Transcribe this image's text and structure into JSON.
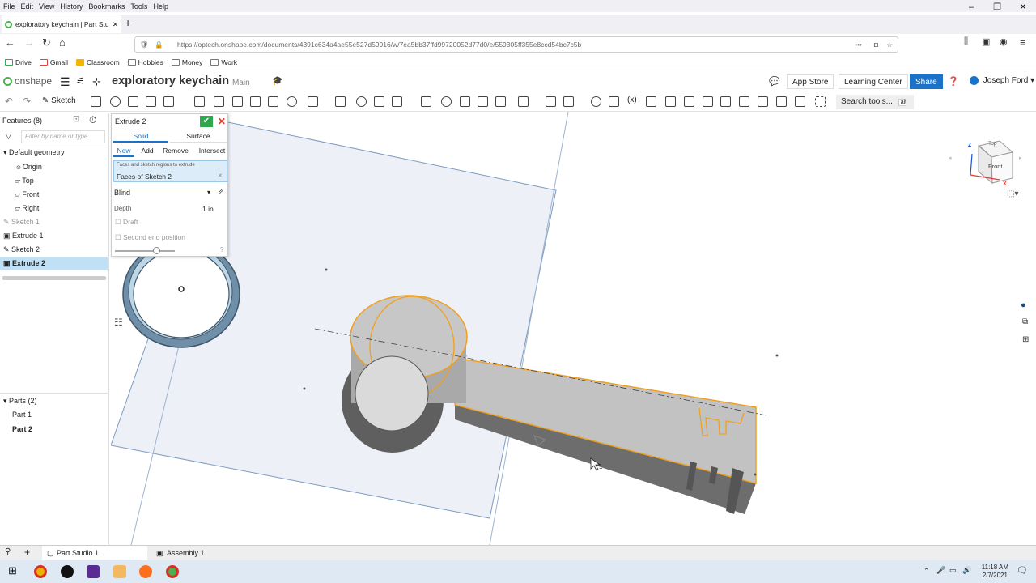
{
  "browser": {
    "menu": [
      "File",
      "Edit",
      "View",
      "History",
      "Bookmarks",
      "Tools",
      "Help"
    ],
    "tab_title": "exploratory keychain | Part Stu",
    "url": "https://optech.onshape.com/documents/4391c634a4ae55e527d59916/w/7ea5bb37ffd99720052d77d0/e/559305ff355e8ccd54bc7c5b",
    "bookmarks": [
      "Drive",
      "Gmail",
      "Classroom",
      "Hobbies",
      "Money",
      "Work"
    ]
  },
  "app": {
    "logo_text": "onshape",
    "document_title": "exploratory keychain",
    "branch": "Main",
    "app_store": "App Store",
    "learning_center": "Learning Center",
    "share": "Share",
    "user": "Joseph Ford"
  },
  "toolbar": {
    "sketch": "Sketch",
    "search_tools": "Search tools...",
    "search_shortcut": "alt C"
  },
  "features": {
    "header": "Features (8)",
    "filter_placeholder": "Filter by name or type",
    "default_geometry": "Default geometry",
    "items": [
      "Origin",
      "Top",
      "Front",
      "Right",
      "Sketch 1",
      "Extrude 1",
      "Sketch 2",
      "Extrude 2"
    ],
    "parts_header": "Parts (2)",
    "parts": [
      "Part 1",
      "Part 2"
    ]
  },
  "dialog": {
    "title": "Extrude 2",
    "type_tabs": [
      "Solid",
      "Surface"
    ],
    "operations": [
      "New",
      "Add",
      "Remove",
      "Intersect"
    ],
    "faces_hint": "Faces and sketch regions to extrude",
    "faces_value": "Faces of Sketch 2",
    "end_type": "Blind",
    "depth_label": "Depth",
    "depth_value": "1 in",
    "draft": "Draft",
    "second_end": "Second end position"
  },
  "viewcube": {
    "top": "Top",
    "front": "Front",
    "axis_z": "Z",
    "axis_x": "X"
  },
  "bottom_tabs": [
    "Part Studio 1",
    "Assembly 1"
  ],
  "taskbar": {
    "time": "11:18 AM",
    "date": "2/7/2021"
  },
  "colors": {
    "accent": "#1a73c8",
    "selection": "#f0a020",
    "ok": "#2ea84b",
    "selected_row": "#bfe0f5"
  }
}
